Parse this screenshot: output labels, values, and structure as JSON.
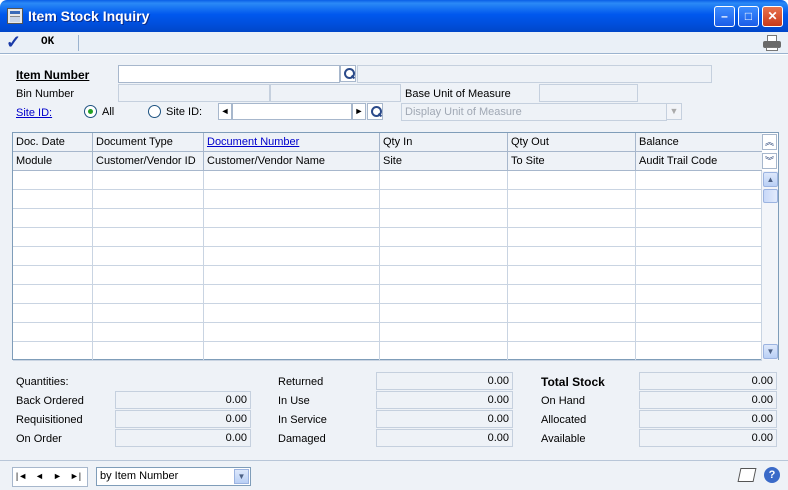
{
  "window": {
    "title": "Item Stock Inquiry",
    "minimize": "–",
    "maximize": "□",
    "close": "✕"
  },
  "toolbar": {
    "ok_label": "OK",
    "ok_icon": "checkmark-icon",
    "print_icon": "printer-icon"
  },
  "header": {
    "item_number_label": "Item Number",
    "item_number_value": "",
    "item_description_value": "",
    "bin_number_label": "Bin Number",
    "bin_number_value": "",
    "base_uom_label": "Base Unit of Measure",
    "base_uom_value": "",
    "site_id_label": "Site ID:",
    "radio_all_label": "All",
    "radio_site_label": "Site ID:",
    "site_id_value": "",
    "display_uom_placeholder": "Display Unit of Measure",
    "selected_radio": "All"
  },
  "grid": {
    "header_row1": [
      "Doc. Date",
      "Document Type",
      "Document Number",
      "Qty In",
      "Qty Out",
      "Balance"
    ],
    "header_row2": [
      "Module",
      "Customer/Vendor ID",
      "Customer/Vendor Name",
      "Site",
      "To Site",
      "Audit Trail Code"
    ],
    "link_column": "Document Number",
    "rows": 10
  },
  "totals": {
    "quantities_label": "Quantities:",
    "left": [
      {
        "label": "Back Ordered",
        "value": "0.00"
      },
      {
        "label": "Requisitioned",
        "value": "0.00"
      },
      {
        "label": "On Order",
        "value": "0.00"
      }
    ],
    "middle": [
      {
        "label": "Returned",
        "value": "0.00"
      },
      {
        "label": "In Use",
        "value": "0.00"
      },
      {
        "label": "In Service",
        "value": "0.00"
      },
      {
        "label": "Damaged",
        "value": "0.00"
      }
    ],
    "right": [
      {
        "label": "Total Stock",
        "value": "0.00"
      },
      {
        "label": "On Hand",
        "value": "0.00"
      },
      {
        "label": "Allocated",
        "value": "0.00"
      },
      {
        "label": "Available",
        "value": "0.00"
      }
    ]
  },
  "footer": {
    "sort_value": "by Item Number",
    "nav_first": "|◄",
    "nav_prev": "◄",
    "nav_next": "►",
    "nav_last": "►|",
    "help_glyph": "?"
  },
  "colors": {
    "titlebar": "#0058ee",
    "panel": "#eef2f7",
    "link": "#0000cc",
    "radio_selected": "#22a022"
  }
}
